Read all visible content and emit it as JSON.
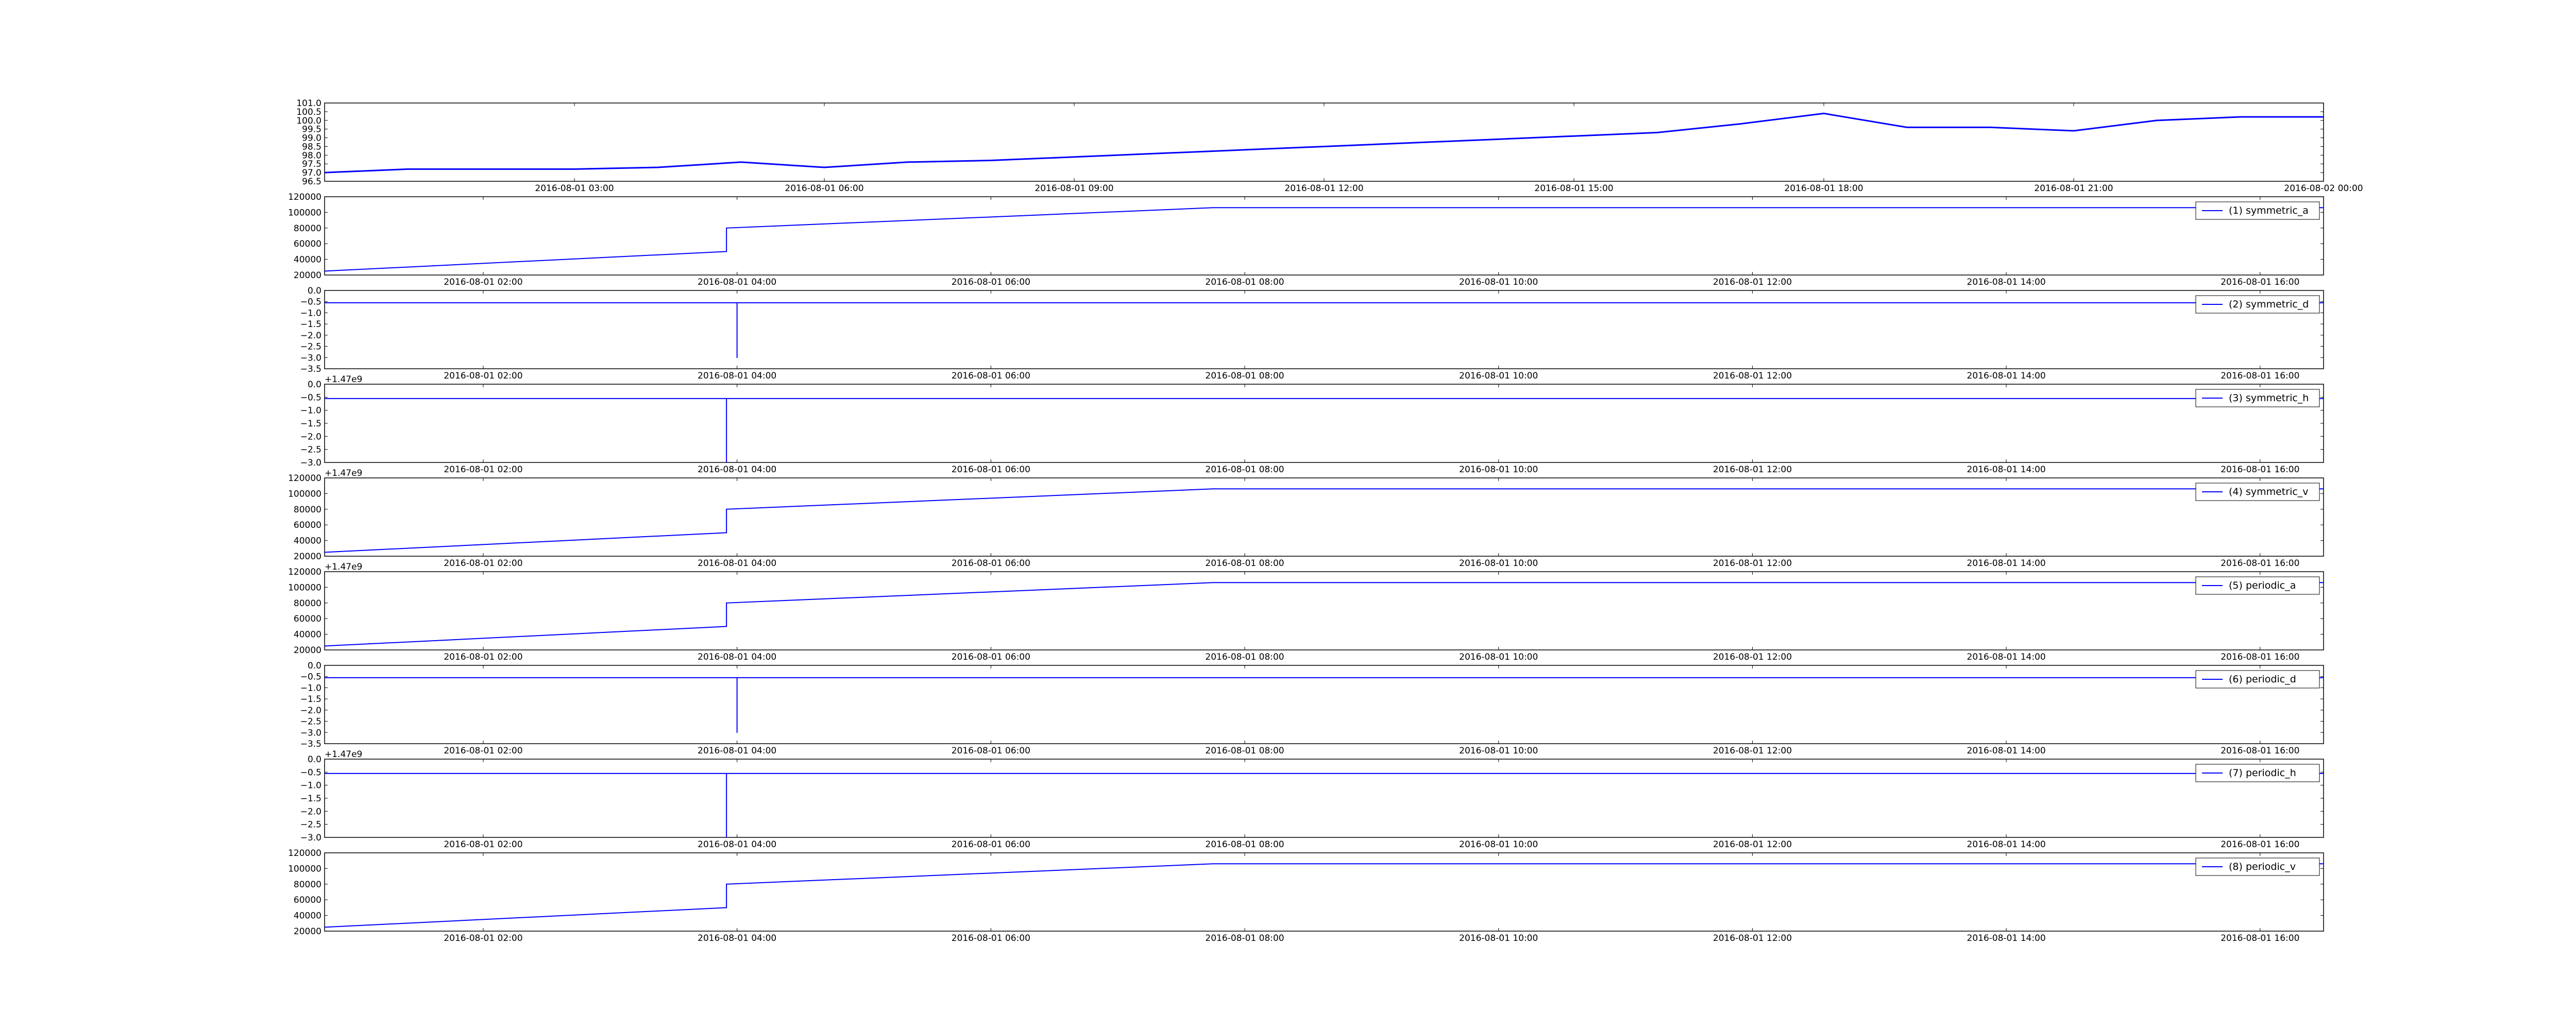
{
  "figure": {
    "background": "#ffffff",
    "line_color": "#0000ff",
    "legend_line_color": "#0000ff"
  },
  "chart_data": [
    {
      "type": "line",
      "offset_label": "",
      "ylim": [
        96.5,
        101.0
      ],
      "y_ticks": [
        96.5,
        97.0,
        97.5,
        98.0,
        98.5,
        99.0,
        99.5,
        100.0,
        100.5,
        101.0
      ],
      "y_tick_labels": [
        "96.5",
        "97.0",
        "97.5",
        "98.0",
        "98.5",
        "99.0",
        "99.5",
        "100.0",
        "100.5",
        "101.0"
      ],
      "x_tick_labels": [
        "2016-08-01 03:00",
        "2016-08-01 06:00",
        "2016-08-01 09:00",
        "2016-08-01 12:00",
        "2016-08-01 15:00",
        "2016-08-01 18:00",
        "2016-08-01 21:00",
        "2016-08-02 00:00"
      ],
      "legend": "",
      "series": [
        {
          "name": "",
          "x": [
            "2016-08-01 00:00",
            "2016-08-01 01:00",
            "2016-08-01 02:00",
            "2016-08-01 03:00",
            "2016-08-01 04:00",
            "2016-08-01 05:00",
            "2016-08-01 06:00",
            "2016-08-01 07:00",
            "2016-08-01 08:00",
            "2016-08-01 16:00",
            "2016-08-01 17:00",
            "2016-08-01 18:00",
            "2016-08-01 19:00",
            "2016-08-01 20:00",
            "2016-08-01 21:00",
            "2016-08-01 22:00",
            "2016-08-01 23:00",
            "2016-08-02 00:00"
          ],
          "y": [
            97.0,
            97.2,
            97.2,
            97.2,
            97.3,
            97.6,
            97.3,
            97.6,
            97.7,
            99.3,
            99.8,
            100.4,
            99.6,
            99.6,
            99.4,
            100.0,
            100.2,
            100.2
          ]
        }
      ]
    },
    {
      "type": "line",
      "offset_label": "",
      "ylim": [
        20000,
        120000
      ],
      "y_ticks": [
        20000,
        40000,
        60000,
        80000,
        100000,
        120000
      ],
      "y_tick_labels": [
        "20000",
        "40000",
        "60000",
        "80000",
        "100000",
        "120000"
      ],
      "x_tick_labels": [
        "2016-08-01 02:00",
        "2016-08-01 04:00",
        "2016-08-01 06:00",
        "2016-08-01 08:00",
        "2016-08-01 10:00",
        "2016-08-01 12:00",
        "2016-08-01 14:00",
        "2016-08-01 16:00"
      ],
      "legend": "(1) symmetric_a",
      "series": [
        {
          "name": "(1) symmetric_a",
          "x": [
            "2016-08-01 00:45",
            "2016-08-01 03:55",
            "2016-08-01 03:55",
            "2016-08-01 07:45",
            "2016-08-01 16:30"
          ],
          "y": [
            25000,
            50000,
            80000,
            106000,
            106000
          ]
        }
      ]
    },
    {
      "type": "line",
      "offset_label": "",
      "ylim": [
        -3.5,
        0.0
      ],
      "y_ticks": [
        -3.5,
        -3.0,
        -2.5,
        -2.0,
        -1.5,
        -1.0,
        -0.5,
        0.0
      ],
      "y_tick_labels": [
        "−3.5",
        "−3.0",
        "−2.5",
        "−2.0",
        "−1.5",
        "−1.0",
        "−0.5",
        "0.0"
      ],
      "x_tick_labels": [
        "2016-08-01 02:00",
        "2016-08-01 04:00",
        "2016-08-01 06:00",
        "2016-08-01 08:00",
        "2016-08-01 10:00",
        "2016-08-01 12:00",
        "2016-08-01 14:00",
        "2016-08-01 16:00"
      ],
      "legend": "(2) symmetric_d",
      "series": [
        {
          "name": "(2) symmetric_d",
          "x": [
            "2016-08-01 00:45",
            "2016-08-01 04:00",
            "2016-08-01 04:00",
            "2016-08-01 04:00",
            "2016-08-01 07:45",
            "2016-08-01 16:30"
          ],
          "y": [
            -0.55,
            -0.55,
            -3.0,
            -0.55,
            -0.55,
            -0.55
          ]
        }
      ]
    },
    {
      "type": "line",
      "offset_label": "+1.47e9",
      "ylim": [
        -3.0,
        0.0
      ],
      "y_ticks": [
        -3.0,
        -2.5,
        -2.0,
        -1.5,
        -1.0,
        -0.5,
        0.0
      ],
      "y_tick_labels": [
        "−3.0",
        "−2.5",
        "−2.0",
        "−1.5",
        "−1.0",
        "−0.5",
        "0.0"
      ],
      "x_tick_labels": [
        "2016-08-01 02:00",
        "2016-08-01 04:00",
        "2016-08-01 06:00",
        "2016-08-01 08:00",
        "2016-08-01 10:00",
        "2016-08-01 12:00",
        "2016-08-01 14:00",
        "2016-08-01 16:00"
      ],
      "legend": "(3) symmetric_h",
      "series": [
        {
          "name": "(3) symmetric_h",
          "x": [
            "2016-08-01 00:45",
            "2016-08-01 03:55",
            "2016-08-01 03:55",
            "2016-08-01 03:55",
            "2016-08-01 07:45",
            "2016-08-01 16:30"
          ],
          "y": [
            -0.55,
            -0.55,
            -3.0,
            -0.55,
            -0.55,
            -0.55
          ]
        }
      ]
    },
    {
      "type": "line",
      "offset_label": "+1.47e9",
      "ylim": [
        20000,
        120000
      ],
      "y_ticks": [
        20000,
        40000,
        60000,
        80000,
        100000,
        120000
      ],
      "y_tick_labels": [
        "20000",
        "40000",
        "60000",
        "80000",
        "100000",
        "120000"
      ],
      "x_tick_labels": [
        "2016-08-01 02:00",
        "2016-08-01 04:00",
        "2016-08-01 06:00",
        "2016-08-01 08:00",
        "2016-08-01 10:00",
        "2016-08-01 12:00",
        "2016-08-01 14:00",
        "2016-08-01 16:00"
      ],
      "legend": "(4) symmetric_v",
      "series": [
        {
          "name": "(4) symmetric_v",
          "x": [
            "2016-08-01 00:45",
            "2016-08-01 03:55",
            "2016-08-01 03:55",
            "2016-08-01 07:45",
            "2016-08-01 16:30"
          ],
          "y": [
            25000,
            50000,
            80000,
            106000,
            106000
          ]
        }
      ]
    },
    {
      "type": "line",
      "offset_label": "+1.47e9",
      "ylim": [
        20000,
        120000
      ],
      "y_ticks": [
        20000,
        40000,
        60000,
        80000,
        100000,
        120000
      ],
      "y_tick_labels": [
        "20000",
        "40000",
        "60000",
        "80000",
        "100000",
        "120000"
      ],
      "x_tick_labels": [
        "2016-08-01 02:00",
        "2016-08-01 04:00",
        "2016-08-01 06:00",
        "2016-08-01 08:00",
        "2016-08-01 10:00",
        "2016-08-01 12:00",
        "2016-08-01 14:00",
        "2016-08-01 16:00"
      ],
      "legend": "(5) periodic_a",
      "series": [
        {
          "name": "(5) periodic_a",
          "x": [
            "2016-08-01 00:45",
            "2016-08-01 03:55",
            "2016-08-01 03:55",
            "2016-08-01 07:45",
            "2016-08-01 16:30"
          ],
          "y": [
            25000,
            50000,
            80000,
            106000,
            106000
          ]
        }
      ]
    },
    {
      "type": "line",
      "offset_label": "",
      "ylim": [
        -3.5,
        0.0
      ],
      "y_ticks": [
        -3.5,
        -3.0,
        -2.5,
        -2.0,
        -1.5,
        -1.0,
        -0.5,
        0.0
      ],
      "y_tick_labels": [
        "−3.5",
        "−3.0",
        "−2.5",
        "−2.0",
        "−1.5",
        "−1.0",
        "−0.5",
        "0.0"
      ],
      "x_tick_labels": [
        "2016-08-01 02:00",
        "2016-08-01 04:00",
        "2016-08-01 06:00",
        "2016-08-01 08:00",
        "2016-08-01 10:00",
        "2016-08-01 12:00",
        "2016-08-01 14:00",
        "2016-08-01 16:00"
      ],
      "legend": "(6) periodic_d",
      "series": [
        {
          "name": "(6) periodic_d",
          "x": [
            "2016-08-01 00:45",
            "2016-08-01 04:00",
            "2016-08-01 04:00",
            "2016-08-01 04:00",
            "2016-08-01 07:45",
            "2016-08-01 16:30"
          ],
          "y": [
            -0.55,
            -0.55,
            -3.0,
            -0.55,
            -0.55,
            -0.55
          ]
        }
      ]
    },
    {
      "type": "line",
      "offset_label": "+1.47e9",
      "ylim": [
        -3.0,
        0.0
      ],
      "y_ticks": [
        -3.0,
        -2.5,
        -2.0,
        -1.5,
        -1.0,
        -0.5,
        0.0
      ],
      "y_tick_labels": [
        "−3.0",
        "−2.5",
        "−2.0",
        "−1.5",
        "−1.0",
        "−0.5",
        "0.0"
      ],
      "x_tick_labels": [
        "2016-08-01 02:00",
        "2016-08-01 04:00",
        "2016-08-01 06:00",
        "2016-08-01 08:00",
        "2016-08-01 10:00",
        "2016-08-01 12:00",
        "2016-08-01 14:00",
        "2016-08-01 16:00"
      ],
      "legend": "(7) periodic_h",
      "series": [
        {
          "name": "(7) periodic_h",
          "x": [
            "2016-08-01 00:45",
            "2016-08-01 03:55",
            "2016-08-01 03:55",
            "2016-08-01 03:55",
            "2016-08-01 07:45",
            "2016-08-01 16:30"
          ],
          "y": [
            -0.55,
            -0.55,
            -3.0,
            -0.55,
            -0.55,
            -0.55
          ]
        }
      ]
    },
    {
      "type": "line",
      "offset_label": "",
      "ylim": [
        20000,
        120000
      ],
      "y_ticks": [
        20000,
        40000,
        60000,
        80000,
        100000,
        120000
      ],
      "y_tick_labels": [
        "20000",
        "40000",
        "60000",
        "80000",
        "100000",
        "120000"
      ],
      "x_tick_labels": [
        "2016-08-01 02:00",
        "2016-08-01 04:00",
        "2016-08-01 06:00",
        "2016-08-01 08:00",
        "2016-08-01 10:00",
        "2016-08-01 12:00",
        "2016-08-01 14:00",
        "2016-08-01 16:00"
      ],
      "legend": "(8) periodic_v",
      "series": [
        {
          "name": "(8) periodic_v",
          "x": [
            "2016-08-01 00:45",
            "2016-08-01 03:55",
            "2016-08-01 03:55",
            "2016-08-01 07:45",
            "2016-08-01 16:30"
          ],
          "y": [
            25000,
            50000,
            80000,
            106000,
            106000
          ]
        }
      ]
    }
  ]
}
